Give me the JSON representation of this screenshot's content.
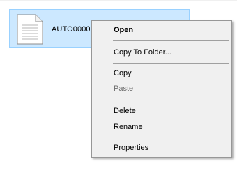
{
  "file": {
    "name": "AUTO0000",
    "icon": "document-icon"
  },
  "context_menu": {
    "items": [
      {
        "label": "Open",
        "bold": true,
        "enabled": true
      },
      {
        "label": "Copy To Folder...",
        "bold": false,
        "enabled": true
      },
      {
        "label": "Copy",
        "bold": false,
        "enabled": true
      },
      {
        "label": "Paste",
        "bold": false,
        "enabled": false
      },
      {
        "label": "Delete",
        "bold": false,
        "enabled": true
      },
      {
        "label": "Rename",
        "bold": false,
        "enabled": true
      },
      {
        "label": "Properties",
        "bold": false,
        "enabled": true
      }
    ]
  },
  "colors": {
    "selection_background": "#cce8ff",
    "selection_border": "#99d1ff",
    "menu_background": "#f0f0f0",
    "disabled_text": "#6d6d6d"
  }
}
